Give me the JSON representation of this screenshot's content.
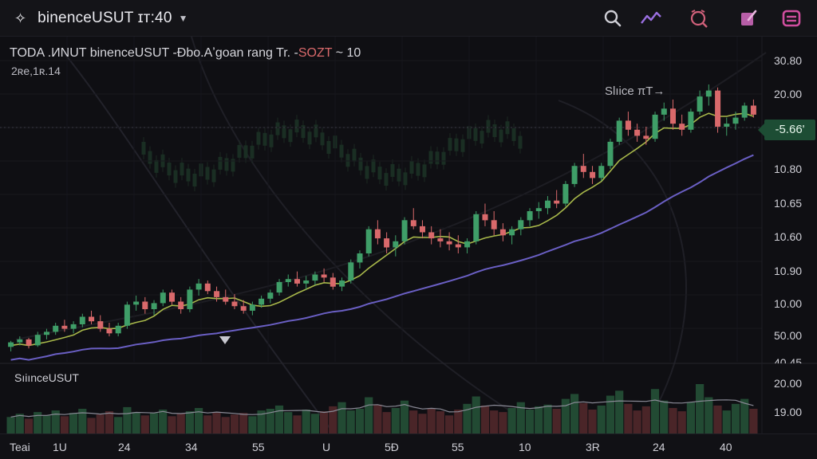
{
  "header": {
    "symbol": "binenceUSUT ɪт:40",
    "icons": [
      "sparkle-icon",
      "chevron-down-icon",
      "search-icon",
      "indicators-icon",
      "alert-icon",
      "draw-icon",
      "layout-icon"
    ],
    "icon_colors": {
      "search": "#cfcfd6",
      "indicators": "#9a6fe0",
      "alert": "#d0607a",
      "draw": "#b85fa8",
      "layout": "#d04e9e"
    }
  },
  "main": {
    "title_prefix": "TODA .ИNUT binenceUSUT -Đbo.Aʼgoan rang Tr. -",
    "title_accent": "SOZT",
    "title_suffix": "~ 10",
    "subtitle": "2ʀe,1ʀ.14",
    "annotation": "Slıice πТ→",
    "current_price": "-5.66'",
    "price_axis": [
      "30.80",
      "20.00",
      "10.80",
      "10.65",
      "10.60",
      "10.90",
      "10.00",
      "50.00",
      "40.45"
    ]
  },
  "volume": {
    "title": "SıiınceUSUT",
    "axis": [
      "20.00",
      "19.00"
    ]
  },
  "xaxis": {
    "ticks": [
      "Teai",
      "1U",
      "24",
      "34",
      "55",
      "U",
      "5Đ",
      "55",
      "10",
      "3R",
      "24",
      "40"
    ]
  },
  "colors": {
    "up": "#3f9e68",
    "down": "#d9696b",
    "ma_fast": "#a8b84a",
    "ma_slow": "#6a5fc4",
    "background": "#0f0f13"
  },
  "chart_data": {
    "type": "candlestick",
    "candles": [
      [
        10.0,
        10.04,
        9.97,
        10.03
      ],
      [
        10.03,
        10.07,
        10.01,
        10.05
      ],
      [
        10.05,
        10.06,
        9.99,
        10.01
      ],
      [
        10.01,
        10.1,
        10.0,
        10.08
      ],
      [
        10.08,
        10.12,
        10.05,
        10.1
      ],
      [
        10.1,
        10.16,
        10.08,
        10.14
      ],
      [
        10.14,
        10.18,
        10.1,
        10.12
      ],
      [
        10.12,
        10.17,
        10.09,
        10.15
      ],
      [
        10.15,
        10.22,
        10.13,
        10.2
      ],
      [
        10.2,
        10.24,
        10.15,
        10.17
      ],
      [
        10.17,
        10.21,
        10.1,
        10.12
      ],
      [
        10.12,
        10.16,
        10.07,
        10.09
      ],
      [
        10.09,
        10.16,
        10.07,
        10.14
      ],
      [
        10.14,
        10.3,
        10.12,
        10.28
      ],
      [
        10.28,
        10.34,
        10.24,
        10.3
      ],
      [
        10.3,
        10.33,
        10.22,
        10.25
      ],
      [
        10.25,
        10.31,
        10.21,
        10.29
      ],
      [
        10.29,
        10.38,
        10.27,
        10.36
      ],
      [
        10.36,
        10.38,
        10.28,
        10.3
      ],
      [
        10.3,
        10.33,
        10.22,
        10.25
      ],
      [
        10.25,
        10.4,
        10.23,
        10.38
      ],
      [
        10.38,
        10.45,
        10.34,
        10.42
      ],
      [
        10.42,
        10.44,
        10.35,
        10.37
      ],
      [
        10.37,
        10.4,
        10.3,
        10.33
      ],
      [
        10.33,
        10.38,
        10.28,
        10.3
      ],
      [
        10.3,
        10.35,
        10.25,
        10.27
      ],
      [
        10.27,
        10.31,
        10.22,
        10.24
      ],
      [
        10.24,
        10.3,
        10.21,
        10.28
      ],
      [
        10.28,
        10.34,
        10.26,
        10.32
      ],
      [
        10.32,
        10.38,
        10.29,
        10.36
      ],
      [
        10.36,
        10.45,
        10.34,
        10.43
      ],
      [
        10.43,
        10.48,
        10.4,
        10.45
      ],
      [
        10.45,
        10.5,
        10.4,
        10.42
      ],
      [
        10.42,
        10.47,
        10.38,
        10.44
      ],
      [
        10.44,
        10.5,
        10.41,
        10.48
      ],
      [
        10.48,
        10.52,
        10.43,
        10.46
      ],
      [
        10.46,
        10.49,
        10.38,
        10.4
      ],
      [
        10.4,
        10.46,
        10.37,
        10.44
      ],
      [
        10.44,
        10.58,
        10.42,
        10.56
      ],
      [
        10.56,
        10.64,
        10.52,
        10.62
      ],
      [
        10.62,
        10.8,
        10.6,
        10.78
      ],
      [
        10.78,
        10.84,
        10.68,
        10.72
      ],
      [
        10.72,
        10.76,
        10.62,
        10.66
      ],
      [
        10.66,
        10.74,
        10.6,
        10.7
      ],
      [
        10.7,
        10.86,
        10.68,
        10.84
      ],
      [
        10.84,
        10.92,
        10.78,
        10.8
      ],
      [
        10.8,
        10.84,
        10.72,
        10.76
      ],
      [
        10.76,
        10.8,
        10.68,
        10.72
      ],
      [
        10.72,
        10.78,
        10.66,
        10.7
      ],
      [
        10.7,
        10.76,
        10.64,
        10.68
      ],
      [
        10.68,
        10.74,
        10.62,
        10.66
      ],
      [
        10.66,
        10.72,
        10.62,
        10.7
      ],
      [
        10.7,
        10.9,
        10.68,
        10.88
      ],
      [
        10.88,
        10.95,
        10.8,
        10.84
      ],
      [
        10.84,
        10.9,
        10.74,
        10.78
      ],
      [
        10.78,
        10.82,
        10.7,
        10.74
      ],
      [
        10.74,
        10.8,
        10.68,
        10.78
      ],
      [
        10.78,
        10.86,
        10.74,
        10.84
      ],
      [
        10.84,
        10.92,
        10.8,
        10.9
      ],
      [
        10.9,
        10.96,
        10.85,
        10.92
      ],
      [
        10.92,
        11.0,
        10.88,
        10.97
      ],
      [
        10.97,
        11.04,
        10.92,
        10.95
      ],
      [
        10.95,
        11.1,
        10.93,
        11.08
      ],
      [
        11.08,
        11.22,
        11.06,
        11.2
      ],
      [
        11.2,
        11.28,
        11.12,
        11.16
      ],
      [
        11.16,
        11.2,
        11.08,
        11.12
      ],
      [
        11.12,
        11.22,
        11.1,
        11.2
      ],
      [
        11.2,
        11.38,
        11.18,
        11.36
      ],
      [
        11.36,
        11.52,
        11.34,
        11.5
      ],
      [
        11.5,
        11.56,
        11.4,
        11.44
      ],
      [
        11.44,
        11.48,
        11.36,
        11.4
      ],
      [
        11.4,
        11.46,
        11.34,
        11.38
      ],
      [
        11.38,
        11.56,
        11.36,
        11.54
      ],
      [
        11.54,
        11.62,
        11.5,
        11.58
      ],
      [
        11.58,
        11.64,
        11.44,
        11.48
      ],
      [
        11.48,
        11.54,
        11.4,
        11.44
      ],
      [
        11.44,
        11.58,
        11.42,
        11.56
      ],
      [
        11.56,
        11.7,
        11.54,
        11.66
      ],
      [
        11.66,
        11.74,
        11.6,
        11.7
      ],
      [
        11.7,
        11.72,
        11.42,
        11.46
      ],
      [
        11.46,
        11.52,
        11.4,
        11.48
      ],
      [
        11.48,
        11.56,
        11.44,
        11.52
      ],
      [
        11.52,
        11.62,
        11.5,
        11.6
      ],
      [
        11.6,
        11.64,
        11.52,
        11.54
      ]
    ],
    "volumes": [
      20,
      24,
      18,
      26,
      22,
      28,
      21,
      25,
      30,
      19,
      23,
      27,
      20,
      32,
      26,
      22,
      25,
      29,
      21,
      24,
      27,
      31,
      22,
      26,
      20,
      23,
      25,
      21,
      28,
      30,
      34,
      26,
      22,
      29,
      24,
      27,
      33,
      38,
      28,
      30,
      44,
      35,
      26,
      31,
      40,
      28,
      24,
      30,
      27,
      22,
      29,
      36,
      45,
      34,
      28,
      26,
      31,
      38,
      29,
      33,
      35,
      30,
      42,
      48,
      37,
      29,
      34,
      46,
      52,
      36,
      28,
      33,
      54,
      40,
      31,
      27,
      38,
      60,
      44,
      34,
      28,
      36,
      42,
      30
    ],
    "price_axis_labels": [
      "30.80",
      "20.00",
      "10.80",
      "10.65",
      "10.60",
      "10.90",
      "10.00",
      "50.00",
      "40.45"
    ],
    "volume_axis_labels": [
      "20.00",
      "19.00"
    ],
    "x_tick_labels": [
      "Teai",
      "1U",
      "24",
      "34",
      "55",
      "U",
      "5Đ",
      "55",
      "10",
      "3R",
      "24",
      "40"
    ],
    "title": "TODA .ИNUT binenceUSUT -Đbo.Aʼgoan rang Tr. -SOZT ~ 10",
    "subtitle": "2ʀe,1ʀ.14",
    "annotation": "Slıice πТ→",
    "current_price": "-5.66'",
    "overlays": [
      "moving-average-fast",
      "moving-average-slow"
    ],
    "grid": true,
    "background_watermark": true
  }
}
